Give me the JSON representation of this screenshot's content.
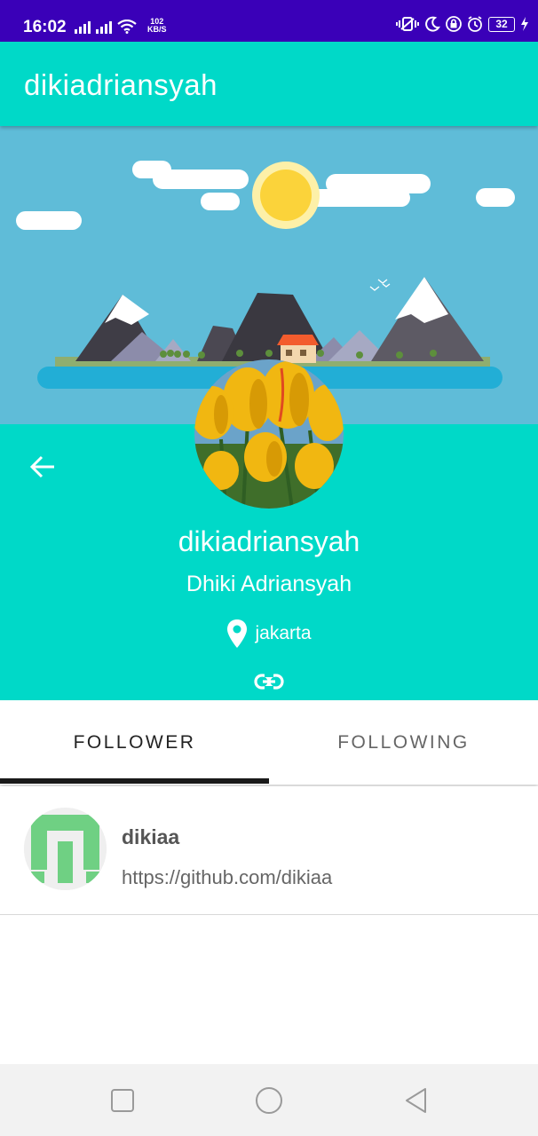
{
  "status_bar": {
    "time": "16:02",
    "speed_value": "102",
    "speed_unit": "KB/S",
    "battery": "32",
    "icons": [
      "signal-icon",
      "signal-icon",
      "wifi-icon",
      "vibrate-icon",
      "moon-icon",
      "lock-icon",
      "alarm-icon",
      "battery-icon",
      "charging-icon"
    ]
  },
  "app_bar": {
    "title": "dikiadriansyah"
  },
  "profile": {
    "username": "dikiadriansyah",
    "full_name": "Dhiki Adriansyah",
    "location": "jakarta",
    "icons": [
      "back-arrow-icon",
      "location-pin-icon",
      "link-icon"
    ]
  },
  "tabs": [
    {
      "label": "FOLLOWER",
      "active": true
    },
    {
      "label": "FOLLOWING",
      "active": false
    }
  ],
  "followers": [
    {
      "name": "dikiaa",
      "url": "https://github.com/dikiaa"
    }
  ],
  "nav_bar": {
    "icons": [
      "recent-apps-icon",
      "home-icon",
      "back-icon"
    ]
  },
  "colors": {
    "status_bar": "#3a00b8",
    "primary": "#00d9c8",
    "banner_sky": "#5fbcd8",
    "tab_indicator": "#1a1a1a"
  }
}
